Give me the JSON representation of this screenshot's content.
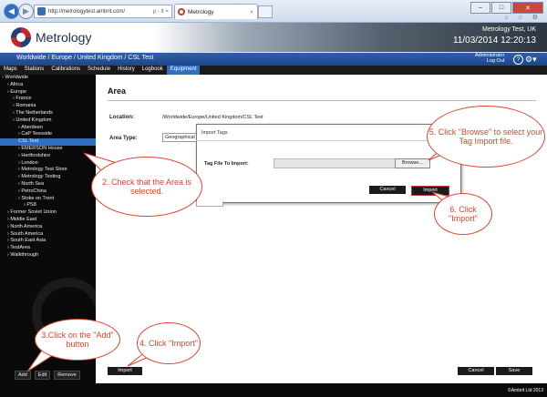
{
  "browser": {
    "address": "http://metrologytest.ambrit.com/",
    "address_tail": "ρ - ¢ ×",
    "tab_title": "Metrology",
    "tab_close": "×",
    "win_min": "–",
    "win_max": "□",
    "win_close": "✕",
    "toolbar_icons": "⌂ ☆ ⚙"
  },
  "header": {
    "logo_text": "Metrology",
    "site": "Metrology Test, UK",
    "date": "11/03/2014",
    "time": "12:20:13"
  },
  "breadcrumb": "Worldwide / Europe / United Kingdom / CSL Test",
  "user": {
    "name": "Administrator",
    "logout": "Log Out"
  },
  "nav": [
    "Maps",
    "Stations",
    "Calibrations",
    "Schedule",
    "History",
    "Logbook",
    "Equipment"
  ],
  "nav_active": "Equipment",
  "tree": [
    {
      "label": "Worldwide",
      "indent": 1
    },
    {
      "label": "Africa",
      "indent": 2
    },
    {
      "label": "Europe",
      "indent": 2
    },
    {
      "label": "France",
      "indent": 3
    },
    {
      "label": "Romania",
      "indent": 3
    },
    {
      "label": "The Netherlands",
      "indent": 3
    },
    {
      "label": "United Kingdom",
      "indent": 3
    },
    {
      "label": "Aberdeen",
      "indent": 4
    },
    {
      "label": "CaP Teesside",
      "indent": 4
    },
    {
      "label": "CSL Test",
      "indent": 4,
      "selected": true
    },
    {
      "label": "EMERSON House",
      "indent": 4
    },
    {
      "label": "Hertfordshire",
      "indent": 4
    },
    {
      "label": "London",
      "indent": 4
    },
    {
      "label": "Metrology Test Store",
      "indent": 4
    },
    {
      "label": "Metrology Testing",
      "indent": 4
    },
    {
      "label": "North Sea",
      "indent": 4
    },
    {
      "label": "PetroChina",
      "indent": 4
    },
    {
      "label": "Stoke on Trent",
      "indent": 4
    },
    {
      "label": "PS8",
      "indent": 5
    },
    {
      "label": "Former Soviet Union",
      "indent": 2
    },
    {
      "label": "Middle East",
      "indent": 2
    },
    {
      "label": "North America",
      "indent": 2
    },
    {
      "label": "South America",
      "indent": 2
    },
    {
      "label": "South East Asia",
      "indent": 2
    },
    {
      "label": "TestArea",
      "indent": 2
    },
    {
      "label": "Walkthrough",
      "indent": 2
    }
  ],
  "sidebar_buttons": {
    "add": "Add",
    "edit": "Edit",
    "remove": "Remove"
  },
  "main": {
    "title": "Area",
    "location_label": "Location:",
    "location_value": "/Worldwide/Europe/United Kingdom/CSL Test",
    "area_type_label": "Area Type:",
    "area_type_value": "Geographical"
  },
  "dialog": {
    "title": "Import Tags",
    "file_label": "Tag File To Import:",
    "browse": "Browse...",
    "cancel": "Cancel",
    "import": "Import"
  },
  "bottom": {
    "import": "Import",
    "cancel": "Cancel",
    "save": "Save"
  },
  "copyright": "©Ambrit Ltd 2013",
  "callouts": {
    "c1": "3.Click on the \"Add\" button",
    "c2": "2. Check that the Area is selected.",
    "c4": "4. Click \"Import\"",
    "c5": "5. Click \"Browse\" to select your Tag Import file.",
    "c6": "6. Click \"Import\""
  },
  "colors": {
    "accent": "#2f6fc1",
    "callout": "#d9462f",
    "nav_bg": "#1a1a1a"
  }
}
